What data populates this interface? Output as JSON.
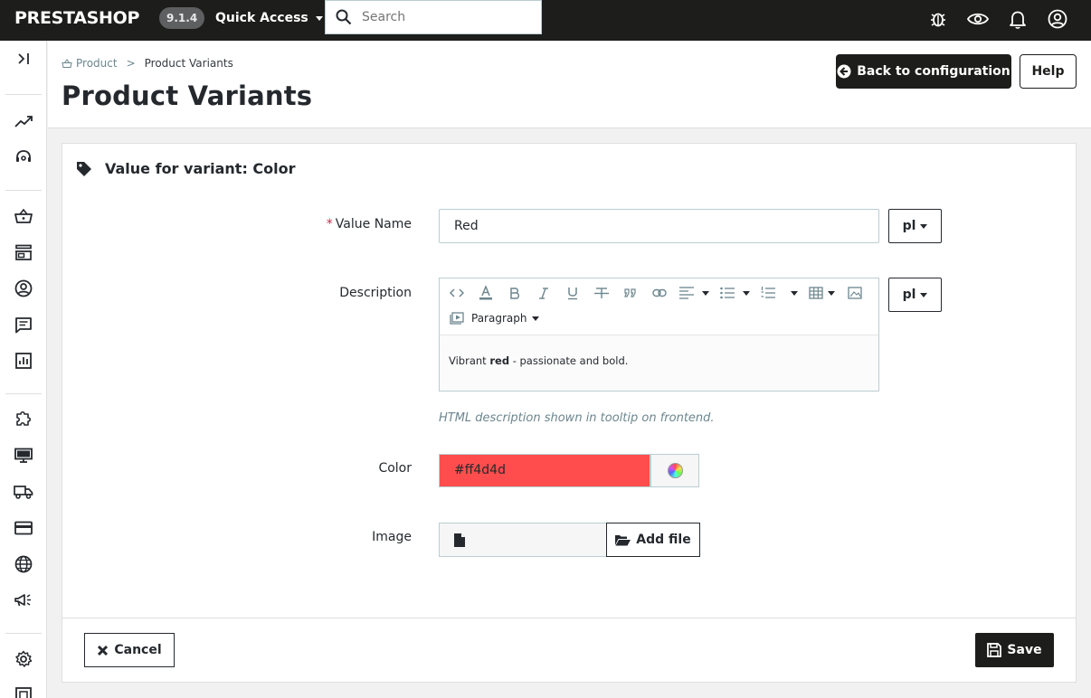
{
  "topbar": {
    "logo": "PRESTASHOP",
    "version": "9.1.4",
    "quick_access": "Quick Access",
    "search_placeholder": "Search",
    "icons": [
      "bug-icon",
      "eye-icon",
      "bell-icon",
      "user-icon"
    ]
  },
  "sidebar": {
    "items": [
      "collapse-icon",
      "stats-trend-icon",
      "support-icon",
      "basket-icon",
      "store-icon",
      "customer-icon",
      "messages-icon",
      "stats-icon",
      "modules-icon",
      "design-icon",
      "shipping-icon",
      "payment-icon",
      "international-icon",
      "marketing-icon",
      "settings-icon",
      "advanced-icon"
    ]
  },
  "header": {
    "breadcrumb_parent": "Product",
    "breadcrumb_separator": ">",
    "breadcrumb_current": "Product Variants",
    "title": "Product Variants",
    "back_button": "Back to configuration",
    "help_button": "Help"
  },
  "form": {
    "heading": "Value for variant: Color",
    "value_name_required_mark": "*",
    "value_name_label": "Value Name",
    "value_name": "Red",
    "lang": "pl",
    "description_label": "Description",
    "paragraph_format": "Paragraph",
    "description_pre": "Vibrant ",
    "description_bold": "red",
    "description_post": " - passionate and bold.",
    "description_help": "HTML description shown in tooltip on frontend.",
    "color_label": "Color",
    "color_value": "#ff4d4d",
    "image_label": "Image",
    "add_file": "Add file"
  },
  "footer": {
    "cancel": "Cancel",
    "save": "Save"
  },
  "colors": {
    "topbar": "#1d1d1b",
    "swatch": "#ff4d4d",
    "required": "#d0284c"
  }
}
